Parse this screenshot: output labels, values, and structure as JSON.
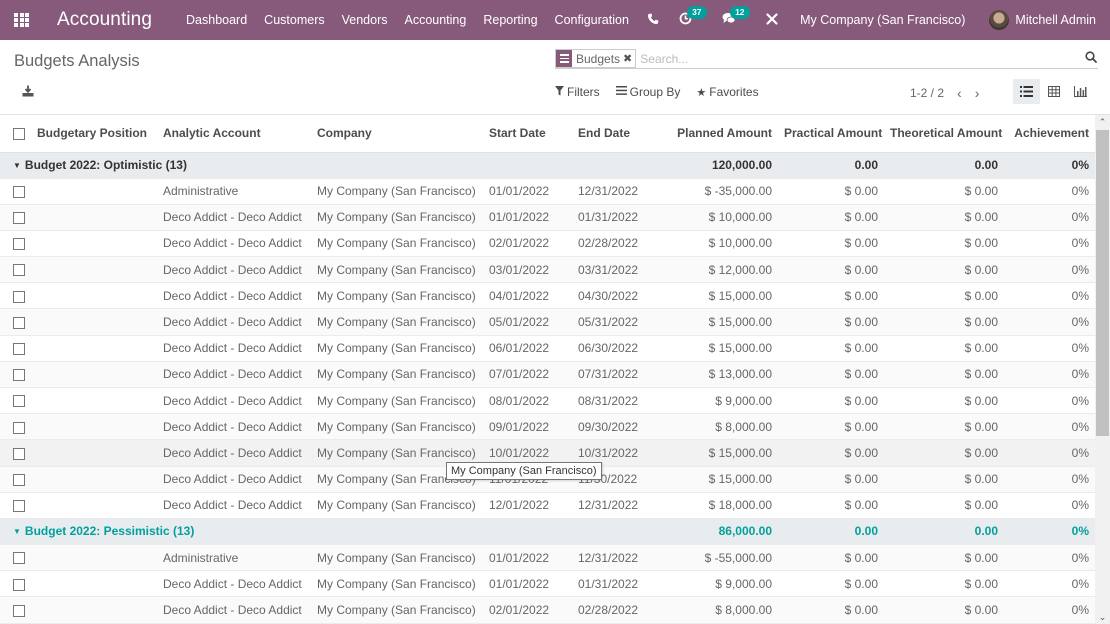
{
  "navbar": {
    "app_name": "Accounting",
    "menu": [
      "Dashboard",
      "Customers",
      "Vendors",
      "Accounting",
      "Reporting",
      "Configuration"
    ],
    "activity_count": "37",
    "message_count": "12",
    "company": "My Company (San Francisco)",
    "user_name": "Mitchell Admin",
    "icons": [
      "apps-icon",
      "phone-icon",
      "activity-clock-icon",
      "chat-icon",
      "debug-tools-icon"
    ]
  },
  "control_panel": {
    "title": "Budgets Analysis",
    "facet_label": "Budgets",
    "search_placeholder": "Search...",
    "filters_label": "Filters",
    "group_by_label": "Group By",
    "favorites_label": "Favorites",
    "pager": "1-2 / 2",
    "views": [
      "list",
      "pivot",
      "graph"
    ],
    "active_view": "list"
  },
  "table": {
    "columns": [
      "Budgetary Position",
      "Analytic Account",
      "Company",
      "Start Date",
      "End Date",
      "Planned Amount",
      "Practical Amount",
      "Theoretical Amount",
      "Achievement"
    ],
    "groups": [
      {
        "label": "Budget 2022: Optimistic (13)",
        "planned": "120,000.00",
        "practical": "0.00",
        "theoretical": "0.00",
        "achievement": "0%",
        "rows": [
          [
            "",
            "Administrative",
            "My Company (San Francisco)",
            "01/01/2022",
            "12/31/2022",
            "$ -35,000.00",
            "$ 0.00",
            "$ 0.00",
            "0%"
          ],
          [
            "",
            "Deco Addict - Deco Addict",
            "My Company (San Francisco)",
            "01/01/2022",
            "01/31/2022",
            "$ 10,000.00",
            "$ 0.00",
            "$ 0.00",
            "0%"
          ],
          [
            "",
            "Deco Addict - Deco Addict",
            "My Company (San Francisco)",
            "02/01/2022",
            "02/28/2022",
            "$ 10,000.00",
            "$ 0.00",
            "$ 0.00",
            "0%"
          ],
          [
            "",
            "Deco Addict - Deco Addict",
            "My Company (San Francisco)",
            "03/01/2022",
            "03/31/2022",
            "$ 12,000.00",
            "$ 0.00",
            "$ 0.00",
            "0%"
          ],
          [
            "",
            "Deco Addict - Deco Addict",
            "My Company (San Francisco)",
            "04/01/2022",
            "04/30/2022",
            "$ 15,000.00",
            "$ 0.00",
            "$ 0.00",
            "0%"
          ],
          [
            "",
            "Deco Addict - Deco Addict",
            "My Company (San Francisco)",
            "05/01/2022",
            "05/31/2022",
            "$ 15,000.00",
            "$ 0.00",
            "$ 0.00",
            "0%"
          ],
          [
            "",
            "Deco Addict - Deco Addict",
            "My Company (San Francisco)",
            "06/01/2022",
            "06/30/2022",
            "$ 15,000.00",
            "$ 0.00",
            "$ 0.00",
            "0%"
          ],
          [
            "",
            "Deco Addict - Deco Addict",
            "My Company (San Francisco)",
            "07/01/2022",
            "07/31/2022",
            "$ 13,000.00",
            "$ 0.00",
            "$ 0.00",
            "0%"
          ],
          [
            "",
            "Deco Addict - Deco Addict",
            "My Company (San Francisco)",
            "08/01/2022",
            "08/31/2022",
            "$ 9,000.00",
            "$ 0.00",
            "$ 0.00",
            "0%"
          ],
          [
            "",
            "Deco Addict - Deco Addict",
            "My Company (San Francisco)",
            "09/01/2022",
            "09/30/2022",
            "$ 8,000.00",
            "$ 0.00",
            "$ 0.00",
            "0%"
          ],
          [
            "",
            "Deco Addict - Deco Addict",
            "My Company (San Francisco)",
            "10/01/2022",
            "10/31/2022",
            "$ 15,000.00",
            "$ 0.00",
            "$ 0.00",
            "0%"
          ],
          [
            "",
            "Deco Addict - Deco Addict",
            "My Company (San Francisco)",
            "11/01/2022",
            "11/30/2022",
            "$ 15,000.00",
            "$ 0.00",
            "$ 0.00",
            "0%"
          ],
          [
            "",
            "Deco Addict - Deco Addict",
            "My Company (San Francisco)",
            "12/01/2022",
            "12/31/2022",
            "$ 18,000.00",
            "$ 0.00",
            "$ 0.00",
            "0%"
          ]
        ]
      },
      {
        "label": "Budget 2022: Pessimistic (13)",
        "planned": "86,000.00",
        "practical": "0.00",
        "theoretical": "0.00",
        "achievement": "0%",
        "rows": [
          [
            "",
            "Administrative",
            "My Company (San Francisco)",
            "01/01/2022",
            "12/31/2022",
            "$ -55,000.00",
            "$ 0.00",
            "$ 0.00",
            "0%"
          ],
          [
            "",
            "Deco Addict - Deco Addict",
            "My Company (San Francisco)",
            "01/01/2022",
            "01/31/2022",
            "$ 9,000.00",
            "$ 0.00",
            "$ 0.00",
            "0%"
          ],
          [
            "",
            "Deco Addict - Deco Addict",
            "My Company (San Francisco)",
            "02/01/2022",
            "02/28/2022",
            "$ 8,000.00",
            "$ 0.00",
            "$ 0.00",
            "0%"
          ]
        ]
      }
    ]
  },
  "tooltip": "My Company (San Francisco)",
  "colors": {
    "brand": "#875a7b",
    "accent": "#00a09d",
    "group_bg": "#e9ecef"
  }
}
